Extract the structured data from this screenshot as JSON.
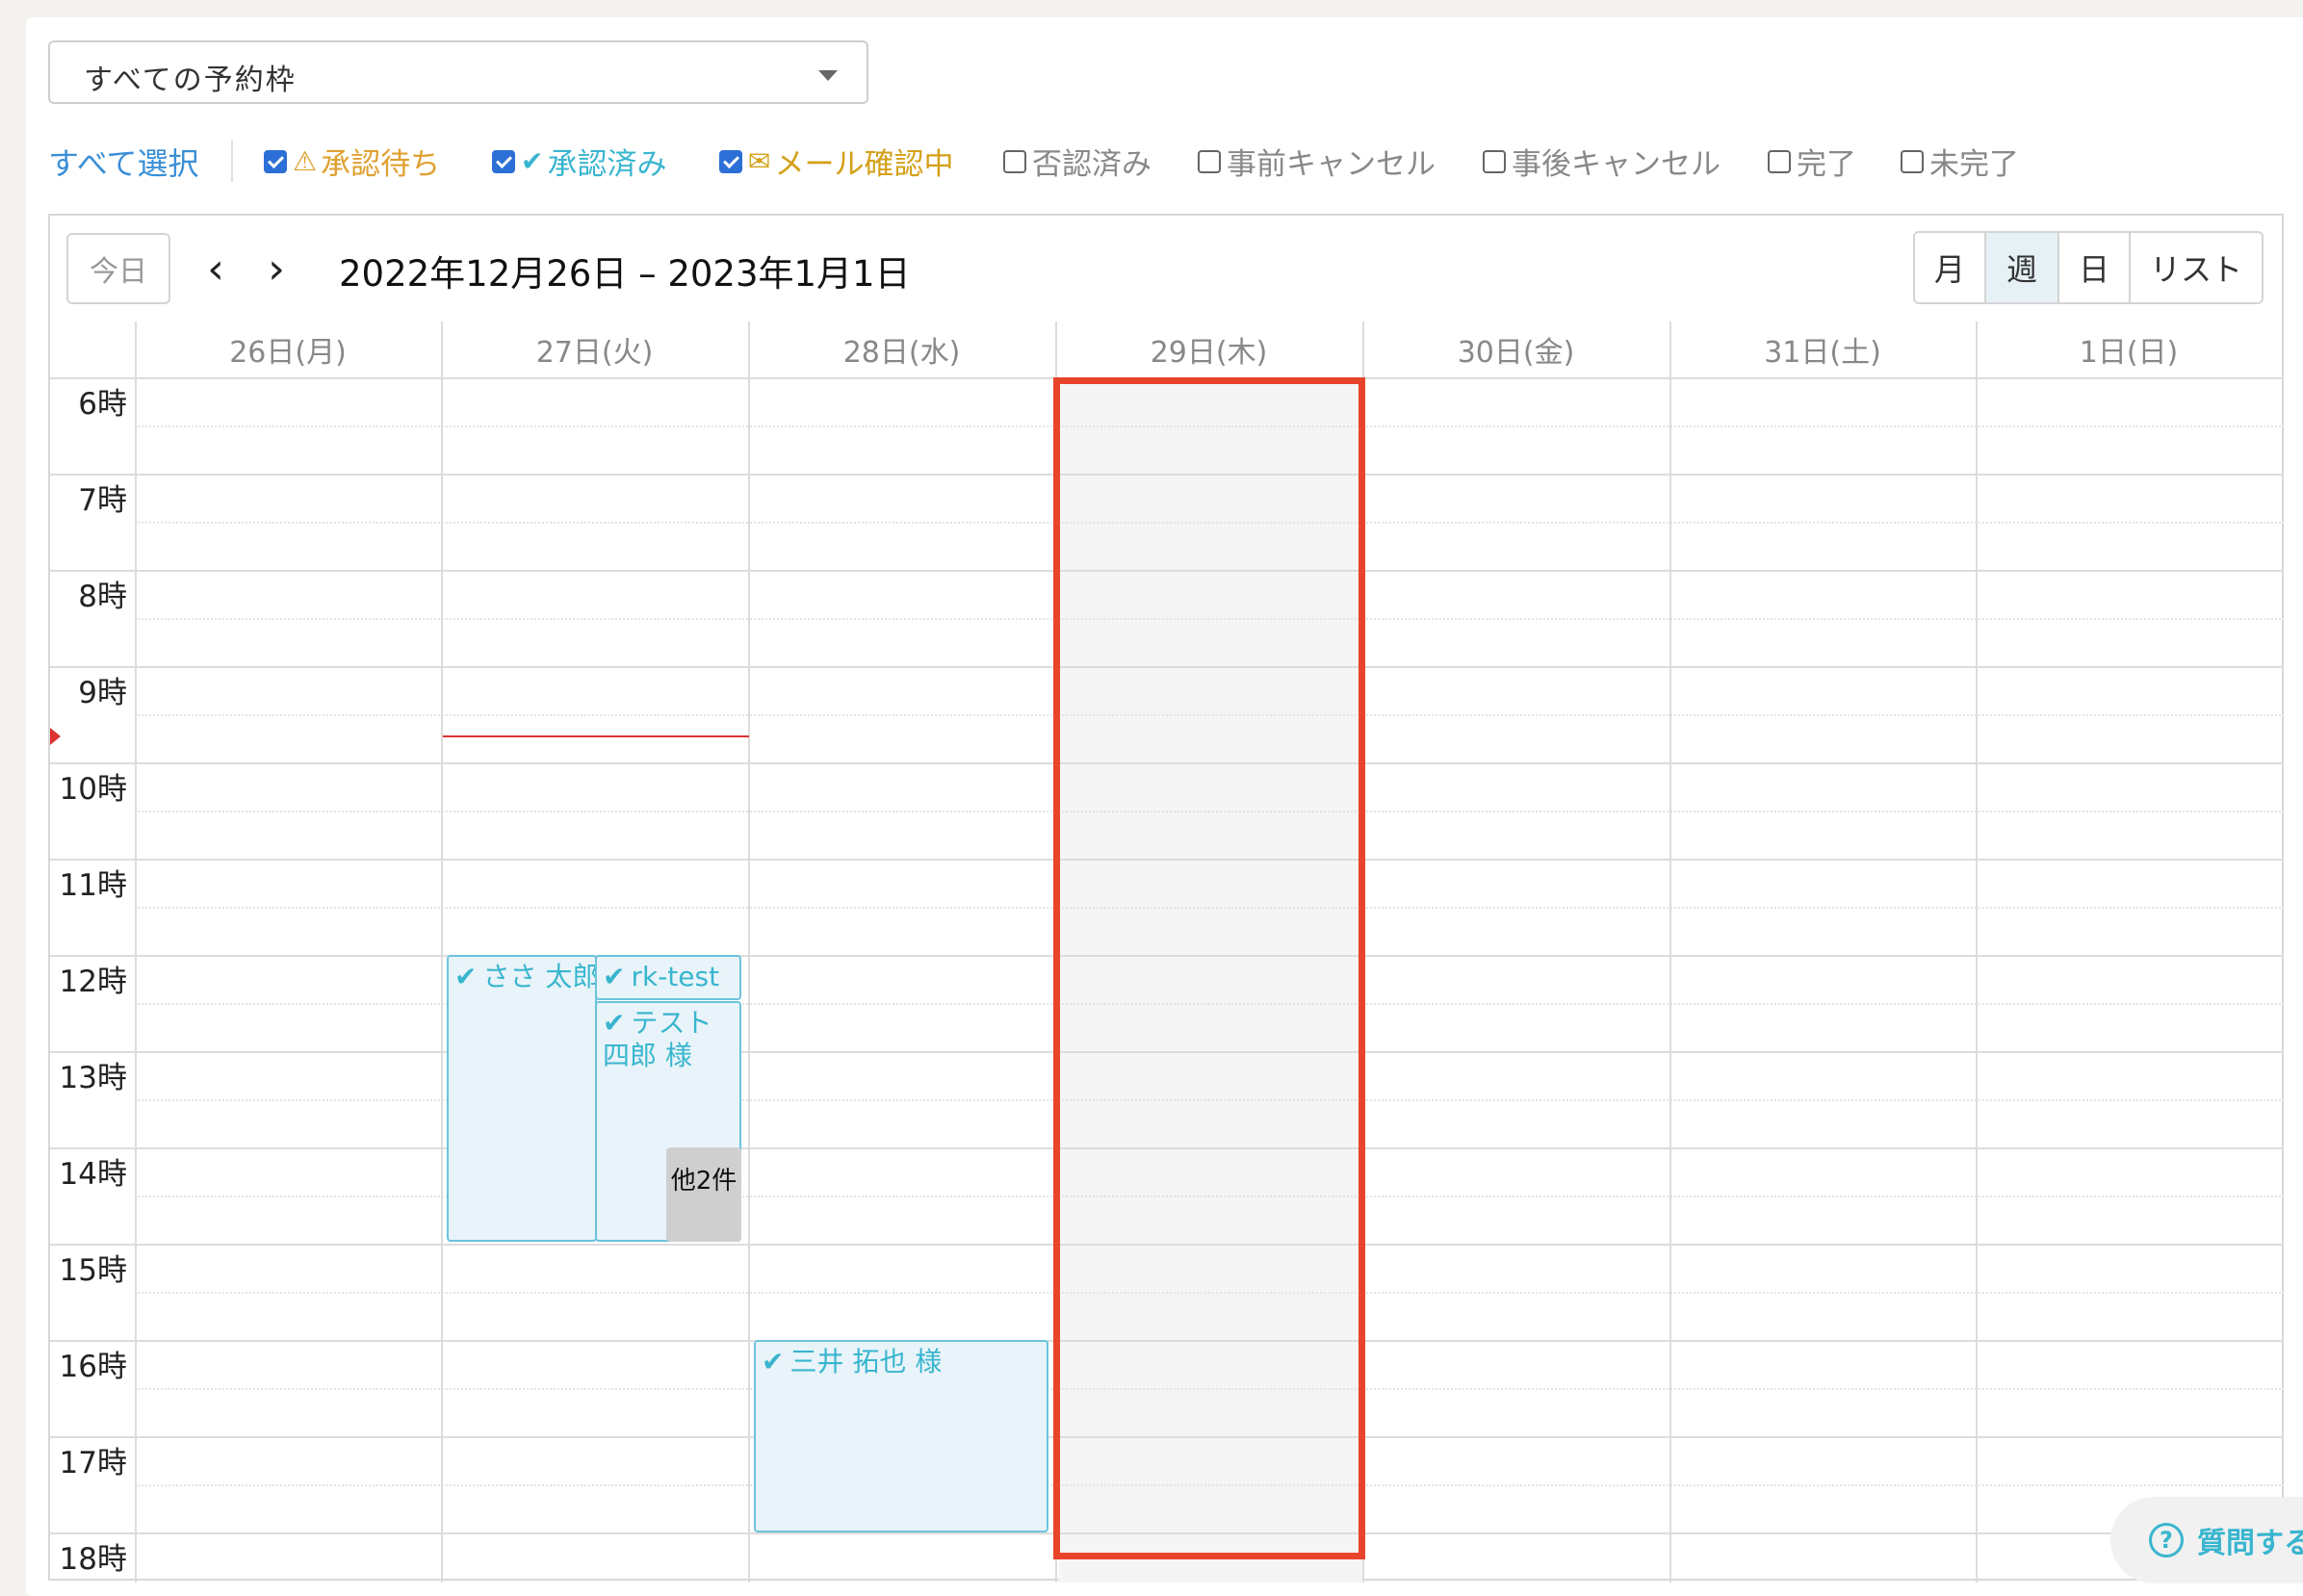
{
  "select": {
    "value": "すべての予約枠"
  },
  "filters": {
    "select_all": "すべて選択",
    "items": [
      {
        "label": "承認待ち",
        "checked": true,
        "icon": "warning-icon",
        "color": "#e0a030"
      },
      {
        "label": "承認済み",
        "checked": true,
        "icon": "check-icon",
        "color": "#39b5cf"
      },
      {
        "label": "メール確認中",
        "checked": true,
        "icon": "envelope-icon",
        "color": "#d4a017"
      },
      {
        "label": "否認済み",
        "checked": false,
        "color": "#888888"
      },
      {
        "label": "事前キャンセル",
        "checked": false,
        "color": "#888888"
      },
      {
        "label": "事後キャンセル",
        "checked": false,
        "color": "#888888"
      },
      {
        "label": "完了",
        "checked": false,
        "color": "#888888"
      },
      {
        "label": "未完了",
        "checked": false,
        "color": "#888888"
      }
    ]
  },
  "toolbar": {
    "today": "今日",
    "prev": "‹",
    "next": "›",
    "range_title": "2022年12月26日 – 2023年1月1日",
    "views": [
      "月",
      "週",
      "日",
      "リスト"
    ],
    "active_view": "週"
  },
  "days": [
    "26日(月)",
    "27日(火)",
    "28日(水)",
    "29日(木)",
    "30日(金)",
    "31日(土)",
    "1日(日)"
  ],
  "hours": [
    "6時",
    "7時",
    "8時",
    "9時",
    "10時",
    "11時",
    "12時",
    "13時",
    "14時",
    "15時",
    "16時",
    "17時",
    "18時"
  ],
  "events": [
    {
      "title": "ささ 太郎",
      "status_icon": "check-icon"
    },
    {
      "title": "rk-test",
      "status_icon": "check-icon"
    },
    {
      "title": "テスト 四郎 様",
      "status_icon": "check-icon"
    },
    {
      "title": "三井 拓也 様",
      "status_icon": "check-icon"
    }
  ],
  "more_badge": "他2件",
  "help": {
    "label": "質問する"
  },
  "colors": {
    "accent": "#39b5cf",
    "highlight": "#e8442b",
    "now_line": "#d33333"
  }
}
